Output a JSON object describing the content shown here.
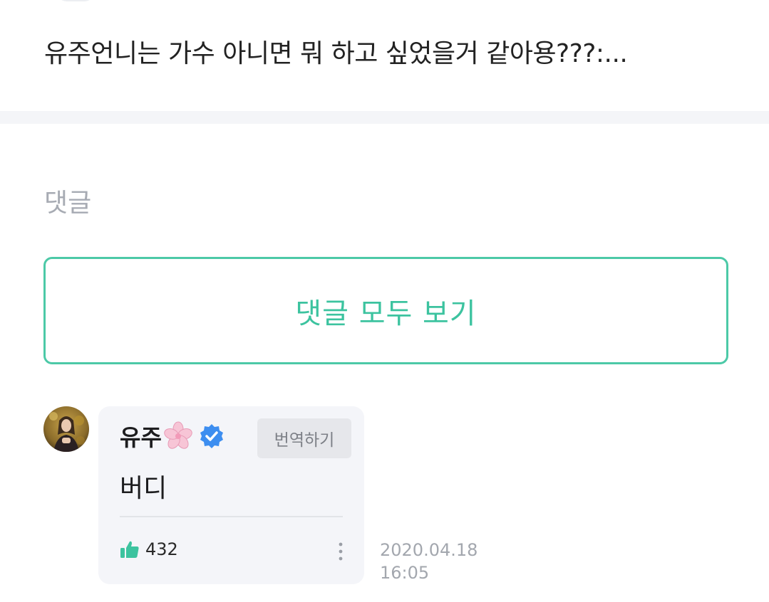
{
  "post": {
    "question": "유주언니는 가수 아니면 뭐 하고 싶었을거 같아용???:..."
  },
  "comments_section": {
    "title": "댓글",
    "view_all_label": "댓글 모두 보기"
  },
  "comment": {
    "author": "유주",
    "badge_icons": [
      "cherry-blossom-icon",
      "verified-badge-icon"
    ],
    "translate_label": "번역하기",
    "body": "버디",
    "like_count": "432",
    "date": "2020.04.18",
    "time": "16:05"
  },
  "colors": {
    "accent": "#3cc39f",
    "verified": "#3d8ef0",
    "muted_text": "#a7abb3",
    "bubble_bg": "#f4f5f9"
  }
}
